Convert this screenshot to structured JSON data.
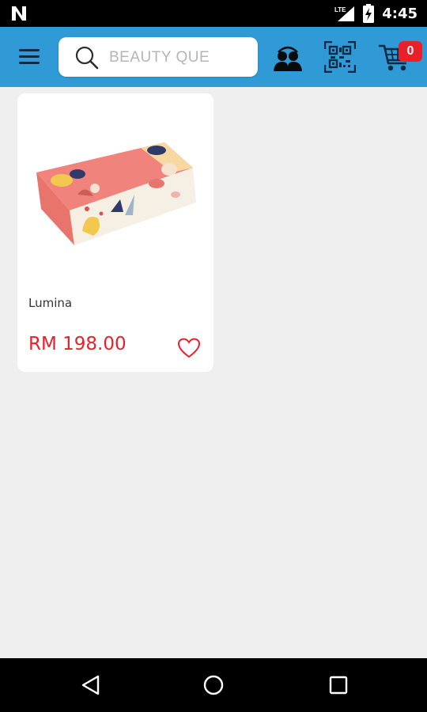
{
  "status_bar": {
    "time": "4:45",
    "network": "LTE",
    "icons": [
      "notification-n-icon",
      "lte-signal-icon",
      "battery-charging-icon"
    ]
  },
  "header": {
    "search": {
      "placeholder": "BEAUTY QUE",
      "value": ""
    },
    "cart": {
      "count": "0"
    },
    "icons": [
      "menu-icon",
      "search-icon",
      "agent-icon",
      "qr-scan-icon",
      "cart-icon"
    ]
  },
  "products": [
    {
      "name": "Lumina",
      "price": "RM 198.00",
      "image": "product-box-image",
      "wishlist_icon": "heart-outline-icon"
    }
  ],
  "nav_bar": {
    "icons": [
      "back-icon",
      "home-icon",
      "recents-icon"
    ]
  },
  "colors": {
    "app_bar": "#2f9ad6",
    "badge": "#e8202a",
    "price": "#e8202a",
    "background": "#efefef"
  }
}
